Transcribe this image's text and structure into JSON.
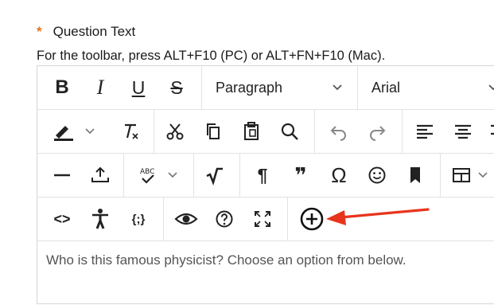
{
  "field": {
    "required_mark": "*",
    "label": "Question Text",
    "hint": "For the toolbar, press ALT+F10 (PC) or ALT+FN+F10 (Mac)."
  },
  "toolbar": {
    "format_block": "Paragraph",
    "font_family": "Arial"
  },
  "editor": {
    "content": "Who is this famous physicist? Choose an option from below."
  },
  "icons": {
    "bold": "B",
    "italic": "I",
    "underline": "U",
    "strikethrough": "S",
    "pilcrow": "¶",
    "blockquote": "❞",
    "omega": "Ω",
    "code": "<>",
    "json": "{;}"
  },
  "colors": {
    "required": "#e8731a",
    "annotation_arrow": "#e8341c",
    "border": "#d6d6d6"
  }
}
